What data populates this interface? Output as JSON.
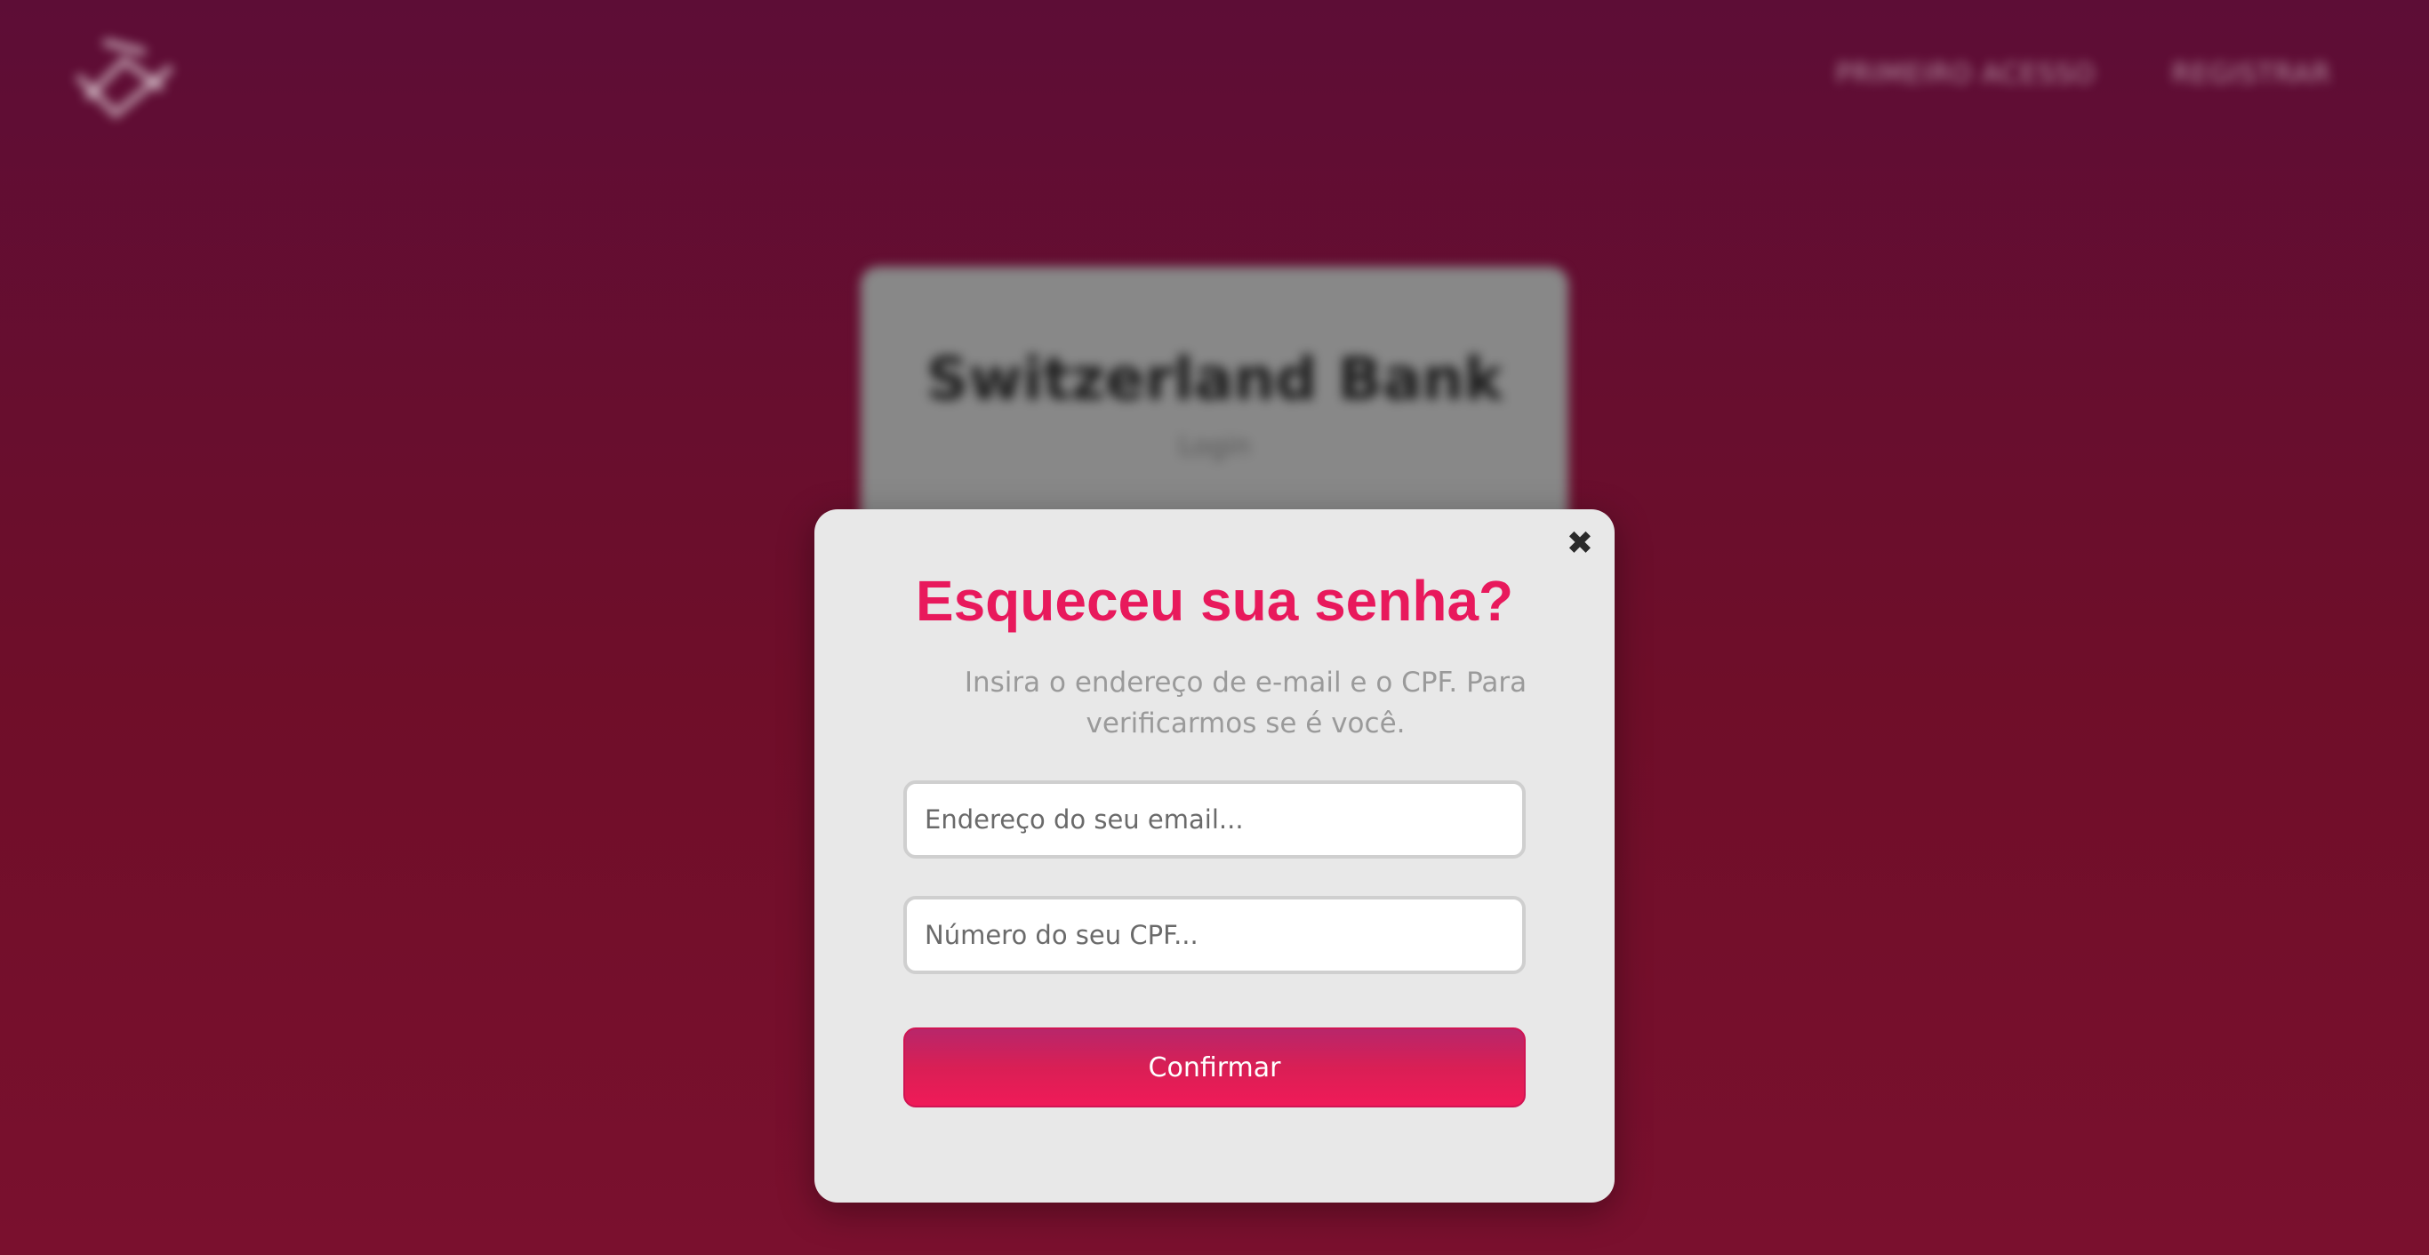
{
  "background": {
    "nav": {
      "links": [
        "PRIMEIRO ACESSO",
        "REGISTRAR"
      ]
    },
    "card": {
      "title": "Switzerland Bank",
      "subtitle": "Login"
    }
  },
  "modal": {
    "close_icon": "close-icon",
    "close_glyph": "✖",
    "title": "Esqueceu sua senha?",
    "description": "Insira o endereço de e-mail e o CPF. Para verificarmos se é você.",
    "email": {
      "placeholder": "Endereço do seu email...",
      "value": ""
    },
    "cpf": {
      "placeholder": "Número do seu CPF...",
      "value": ""
    },
    "confirm_label": "Confirmar"
  },
  "colors": {
    "accent": "#e8195c",
    "background_top": "#5d0d36",
    "background_bottom": "#7a102e",
    "modal_bg": "#e8e8e8"
  }
}
